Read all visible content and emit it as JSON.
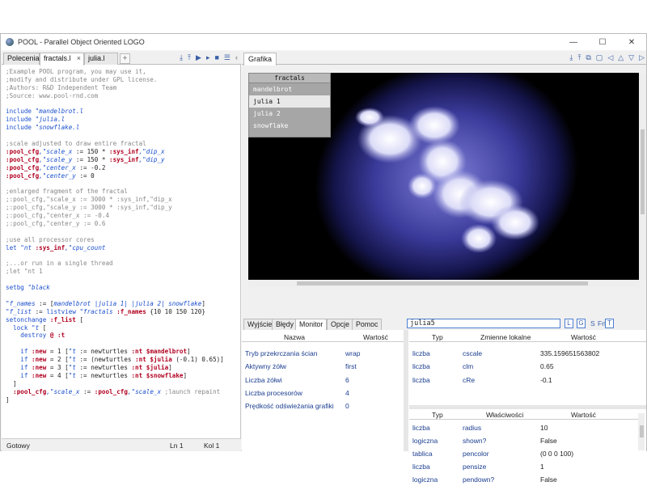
{
  "window": {
    "title": "POOL - Parallel Object Oriented LOGO",
    "controls": {
      "minimize": "—",
      "maximize": "☐",
      "close": "✕"
    }
  },
  "editor": {
    "tabs": [
      {
        "label": "Polecenia"
      },
      {
        "label": "fractals.l"
      },
      {
        "label": "julia.l"
      }
    ],
    "tab_close": "×",
    "tab_add": "+",
    "toolbar": [
      "⤓",
      "⤒",
      "▶",
      "▸",
      "■",
      "☰",
      "‹"
    ],
    "lines": [
      [
        [
          "c",
          ";Example POOL program, you may use it,"
        ]
      ],
      [
        [
          "c",
          ";modify and distribute under GPL license."
        ]
      ],
      [
        [
          "c",
          ";Authors: R&D Independent Team"
        ]
      ],
      [
        [
          "c",
          ";Source: www.pool-rnd.com"
        ]
      ],
      [
        [
          "n",
          ""
        ]
      ],
      [
        [
          "k",
          "include "
        ],
        [
          "s",
          "\"mandelbrot.l"
        ]
      ],
      [
        [
          "k",
          "include "
        ],
        [
          "s",
          "\"julia.l"
        ]
      ],
      [
        [
          "k",
          "include "
        ],
        [
          "s",
          "\"snowflake.l"
        ]
      ],
      [
        [
          "n",
          ""
        ]
      ],
      [
        [
          "c",
          ";scale adjusted to draw entire fractal"
        ]
      ],
      [
        [
          "r",
          ":pool_cfg"
        ],
        [
          "s",
          ",\"scale_x"
        ],
        [
          "n",
          " := 150 * "
        ],
        [
          "r",
          ":sys_inf"
        ],
        [
          "s",
          ",\"dip_x"
        ]
      ],
      [
        [
          "r",
          ":pool_cfg"
        ],
        [
          "s",
          ",\"scale_y"
        ],
        [
          "n",
          " := 150 * "
        ],
        [
          "r",
          ":sys_inf"
        ],
        [
          "s",
          ",\"dip_y"
        ]
      ],
      [
        [
          "r",
          ":pool_cfg"
        ],
        [
          "s",
          ",\"center_x"
        ],
        [
          "n",
          " := -0.2"
        ]
      ],
      [
        [
          "r",
          ":pool_cfg"
        ],
        [
          "s",
          ",\"center_y"
        ],
        [
          "n",
          " := 0"
        ]
      ],
      [
        [
          "n",
          ""
        ]
      ],
      [
        [
          "c",
          ";enlarged fragment of the fractal"
        ]
      ],
      [
        [
          "c",
          ";:pool_cfg,\"scale_x := 3000 * :sys_inf,\"dip_x"
        ]
      ],
      [
        [
          "c",
          ";:pool_cfg,\"scale_y := 3000 * :sys_inf,\"dip_y"
        ]
      ],
      [
        [
          "c",
          ";:pool_cfg,\"center_x := -0.4"
        ]
      ],
      [
        [
          "c",
          ";:pool_cfg,\"center_y := 0.6"
        ]
      ],
      [
        [
          "n",
          ""
        ]
      ],
      [
        [
          "c",
          ";use all processor cores"
        ]
      ],
      [
        [
          "k",
          "let "
        ],
        [
          "s",
          "\"nt "
        ],
        [
          "r",
          ":sys_inf"
        ],
        [
          "s",
          ",\"cpu_count"
        ]
      ],
      [
        [
          "n",
          ""
        ]
      ],
      [
        [
          "c",
          ";...or run in a single thread"
        ]
      ],
      [
        [
          "c",
          ";let \"nt 1"
        ]
      ],
      [
        [
          "n",
          ""
        ]
      ],
      [
        [
          "k",
          "setbg "
        ],
        [
          "s",
          "\"black"
        ]
      ],
      [
        [
          "n",
          ""
        ]
      ],
      [
        [
          "s",
          "\"f_names"
        ],
        [
          "n",
          " := ["
        ],
        [
          "s",
          "mandelbrot |julia 1| |julia 2| snowflake"
        ],
        [
          "n",
          "]"
        ]
      ],
      [
        [
          "s",
          "\"f_list"
        ],
        [
          "n",
          " := "
        ],
        [
          "k",
          "listview "
        ],
        [
          "s",
          "\"fractals "
        ],
        [
          "r",
          ":f_names"
        ],
        [
          "n",
          " {10 10 150 120}"
        ]
      ],
      [
        [
          "k",
          "setonchange "
        ],
        [
          "r",
          ":f_list"
        ],
        [
          "n",
          " ["
        ]
      ],
      [
        [
          "n",
          "  "
        ],
        [
          "k",
          "lock "
        ],
        [
          "s",
          "\"t"
        ],
        [
          "n",
          " ["
        ]
      ],
      [
        [
          "n",
          "    "
        ],
        [
          "k",
          "destroy "
        ],
        [
          "r",
          "@ :t"
        ]
      ],
      [
        [
          "n",
          ""
        ]
      ],
      [
        [
          "n",
          "    "
        ],
        [
          "k",
          "if "
        ],
        [
          "r",
          ":new"
        ],
        [
          "n",
          " = 1 ["
        ],
        [
          "s",
          "\"t"
        ],
        [
          "n",
          " := newturtles "
        ],
        [
          "r",
          ":nt $mandelbrot"
        ],
        [
          "n",
          "]"
        ]
      ],
      [
        [
          "n",
          "    "
        ],
        [
          "k",
          "if "
        ],
        [
          "r",
          ":new"
        ],
        [
          "n",
          " = 2 ["
        ],
        [
          "s",
          "\"t"
        ],
        [
          "n",
          " := (newturtles "
        ],
        [
          "r",
          ":nt $julia"
        ],
        [
          "n",
          " (-0.1) 0.65)]"
        ]
      ],
      [
        [
          "n",
          "    "
        ],
        [
          "k",
          "if "
        ],
        [
          "r",
          ":new"
        ],
        [
          "n",
          " = 3 ["
        ],
        [
          "s",
          "\"t"
        ],
        [
          "n",
          " := newturtles "
        ],
        [
          "r",
          ":nt $julia"
        ],
        [
          "n",
          "]"
        ]
      ],
      [
        [
          "n",
          "    "
        ],
        [
          "k",
          "if "
        ],
        [
          "r",
          ":new"
        ],
        [
          "n",
          " = 4 ["
        ],
        [
          "s",
          "\"t"
        ],
        [
          "n",
          " := newturtles "
        ],
        [
          "r",
          ":nt $snowflake"
        ],
        [
          "n",
          "]"
        ]
      ],
      [
        [
          "n",
          "  ]"
        ]
      ],
      [
        [
          "n",
          "  "
        ],
        [
          "r",
          ":pool_cfg"
        ],
        [
          "s",
          ",\"scale_x"
        ],
        [
          "n",
          " := "
        ],
        [
          "r",
          ":pool_cfg"
        ],
        [
          "s",
          ",\"scale_x"
        ],
        [
          "c",
          " ;launch repaint"
        ]
      ],
      [
        [
          "n",
          "]"
        ]
      ]
    ],
    "status": {
      "state": "Gotowy",
      "line": "Ln 1",
      "col": "Kol 1"
    }
  },
  "graphics": {
    "tab": "Grafika",
    "toolbar": [
      "⤓",
      "⤒",
      "⧉",
      "▢",
      "◁",
      "△",
      "▽",
      "▷"
    ],
    "listview": {
      "title": "fractals",
      "items": [
        "mandelbrot",
        "julia 1",
        "julia 2",
        "snowflake"
      ],
      "selected_index": 1
    }
  },
  "panel": {
    "tabs": [
      "Wyjście",
      "Błędy",
      "Monitor",
      "Opcje",
      "Pomoc"
    ],
    "active_tab": "Monitor",
    "search_value": "julia5",
    "filters": [
      "L",
      "G",
      "S",
      "Fn",
      "T"
    ],
    "monitor": {
      "headers": {
        "name": "Nazwa",
        "value": "Wartość"
      },
      "rows": [
        {
          "name": "Tryb przekrczania ścian",
          "value": "wrap"
        },
        {
          "name": "Aktywny żółw",
          "value": "first"
        },
        {
          "name": "Liczba żółwi",
          "value": "6"
        },
        {
          "name": "Liczba procesorów",
          "value": "4"
        },
        {
          "name": "Prędkość odświeżania grafiki",
          "value": "0"
        }
      ]
    },
    "locals": {
      "headers": {
        "type": "Typ",
        "name": "Zmienne lokalne",
        "value": "Wartość"
      },
      "rows": [
        {
          "type": "liczba",
          "name": "cscale",
          "value": "335.159651563802"
        },
        {
          "type": "liczba",
          "name": "clm",
          "value": "0.65"
        },
        {
          "type": "liczba",
          "name": "cRe",
          "value": "-0.1"
        }
      ]
    },
    "props": {
      "headers": {
        "type": "Typ",
        "name": "Właściwości",
        "value": "Wartość"
      },
      "rows": [
        {
          "type": "liczba",
          "name": "radius",
          "value": "10"
        },
        {
          "type": "logiczna",
          "name": "shown?",
          "value": "False"
        },
        {
          "type": "tablica",
          "name": "pencolor",
          "value": "(0 0 0 100)"
        },
        {
          "type": "liczba",
          "name": "pensize",
          "value": "1"
        },
        {
          "type": "logiczna",
          "name": "pendown?",
          "value": "False"
        }
      ]
    }
  },
  "colors": {
    "accent": "#1a4fcc",
    "keyword_red": "#b00020",
    "comment": "#888888",
    "fractal_glow": "#3c3c9a"
  }
}
